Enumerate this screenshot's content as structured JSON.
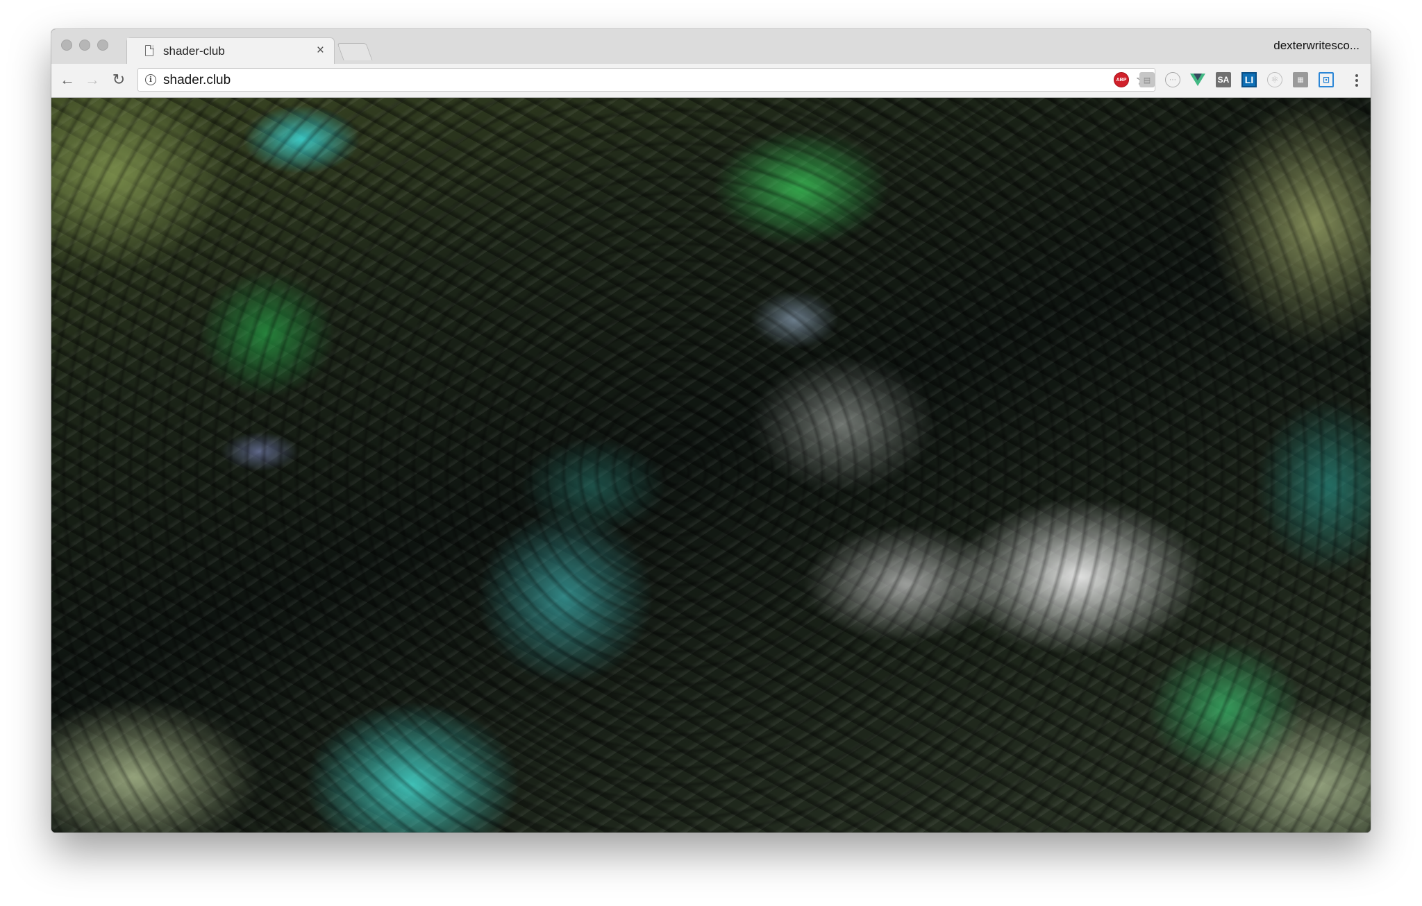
{
  "window": {
    "traffic_lights": [
      "close",
      "minimize",
      "zoom"
    ]
  },
  "tabs": [
    {
      "title": "shader-club",
      "icon": "document-icon",
      "active": true
    }
  ],
  "profile": {
    "name": "dexterwritesco..."
  },
  "toolbar": {
    "back_icon": "←",
    "forward_icon": "→",
    "reload_icon": "↻",
    "url": "shader.club",
    "info_icon": "i",
    "star_icon": "☆"
  },
  "extensions": [
    {
      "name": "adblock-plus",
      "label": "ABP"
    },
    {
      "name": "gray-chat",
      "label": "▤"
    },
    {
      "name": "circle-ext",
      "label": "⋯"
    },
    {
      "name": "vue-devtools",
      "label": ""
    },
    {
      "name": "sa-ext",
      "label": "SA"
    },
    {
      "name": "li-ext",
      "label": "LI"
    },
    {
      "name": "react-devtools",
      "label": "⚛"
    },
    {
      "name": "gray-flag",
      "label": "▦"
    },
    {
      "name": "cast",
      "label": "⊡"
    }
  ],
  "content": {
    "description_colors": {
      "teal": "#46dcd2",
      "green": "#3cc85a",
      "olive": "#3e4a24",
      "silver": "#f0f0f0"
    }
  }
}
